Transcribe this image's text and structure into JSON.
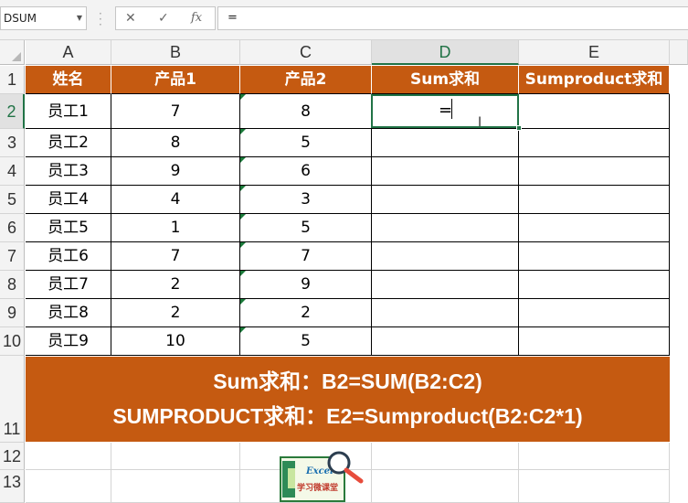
{
  "formula_bar": {
    "name_box": "DSUM",
    "cancel_symbol": "✕",
    "enter_symbol": "✓",
    "fx_symbol": "fx",
    "formula": "="
  },
  "columns": [
    "A",
    "B",
    "C",
    "D",
    "E"
  ],
  "rows": [
    "1",
    "2",
    "3",
    "4",
    "5",
    "6",
    "7",
    "8",
    "9",
    "10",
    "11",
    "12",
    "13"
  ],
  "active_cell": "D2",
  "header_row": [
    "姓名",
    "产品1",
    "产品2",
    "Sum求和",
    "Sumproduct求和"
  ],
  "data_rows": [
    [
      "员工1",
      "7",
      "8"
    ],
    [
      "员工2",
      "8",
      "5"
    ],
    [
      "员工3",
      "9",
      "6"
    ],
    [
      "员工4",
      "4",
      "3"
    ],
    [
      "员工5",
      "1",
      "5"
    ],
    [
      "员工6",
      "7",
      "7"
    ],
    [
      "员工7",
      "2",
      "9"
    ],
    [
      "员工8",
      "2",
      "2"
    ],
    [
      "员工9",
      "10",
      "5"
    ]
  ],
  "editing_text": "=",
  "banner": {
    "line1": "Sum求和：B2=SUM(B2:C2)",
    "line2": "SUMPRODUCT求和：E2=Sumproduct(B2:C2*1)"
  },
  "logo": {
    "top": "Excel",
    "bottom": "学习微课堂"
  },
  "colors": {
    "header_fill": "#c55a11",
    "accent_green": "#217346"
  }
}
